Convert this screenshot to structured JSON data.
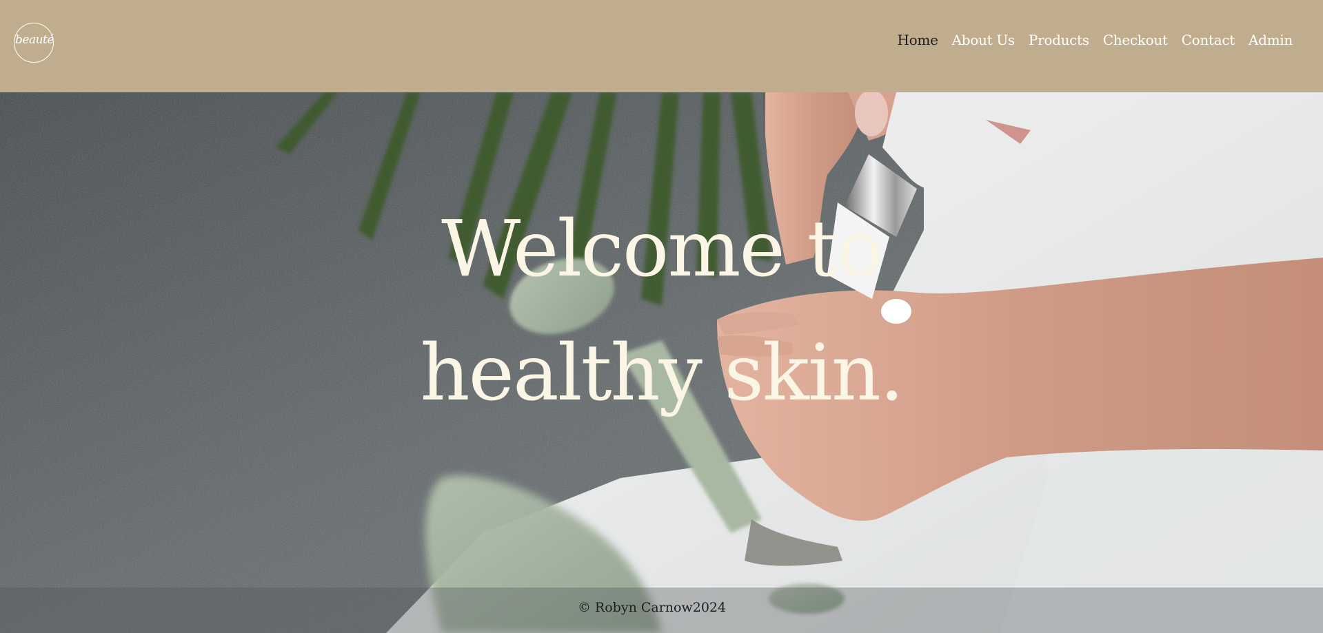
{
  "header": {
    "logo_text": "beauté",
    "nav": [
      {
        "label": "Home",
        "active": true
      },
      {
        "label": "About Us",
        "active": false
      },
      {
        "label": "Products",
        "active": false
      },
      {
        "label": "Checkout",
        "active": false
      },
      {
        "label": "Contact",
        "active": false
      },
      {
        "label": "Admin",
        "active": false
      }
    ]
  },
  "hero": {
    "title_line1": "Welcome to",
    "title_line2": "healthy skin."
  },
  "footer": {
    "copyright": "© Robyn Carnow2024"
  },
  "colors": {
    "header_bg": "#bfad8d",
    "hero_text": "#fbf5e6",
    "active_nav": "#1c1c1c"
  }
}
